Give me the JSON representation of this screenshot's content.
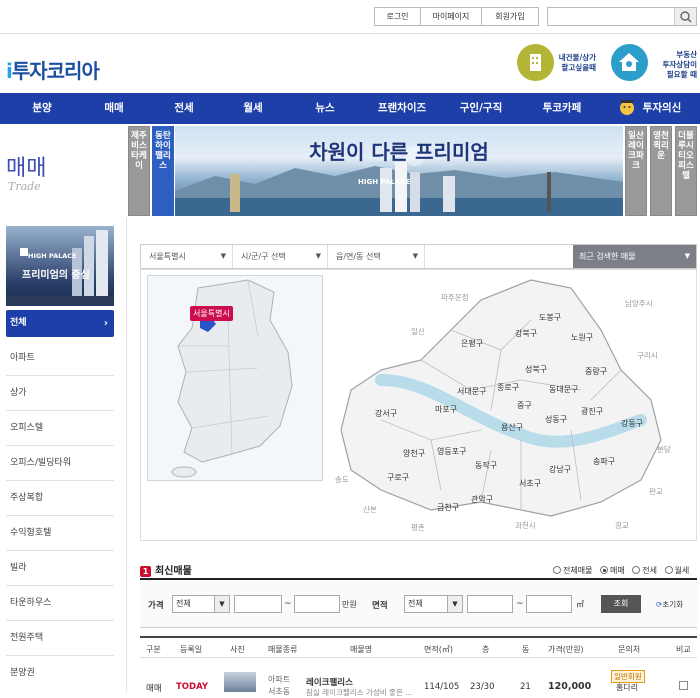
{
  "topbar": {
    "links": [
      "로그인",
      "마이페이지",
      "회원가입"
    ],
    "search_placeholder": ""
  },
  "logo": {
    "prefix": "i",
    "text": "투자코리아"
  },
  "promos": [
    {
      "line1": "내건물/상가",
      "line2": "팔고싶을때"
    },
    {
      "line1": "부동산",
      "line2": "투자상담이",
      "line3": "필요할 때"
    }
  ],
  "nav": [
    "분양",
    "매매",
    "전세",
    "월세",
    "뉴스",
    "프랜차이즈",
    "구인/구직",
    "투코카페",
    "투자의신"
  ],
  "section": {
    "title": "매매",
    "subtitle": "Trade"
  },
  "vtabs_left": [
    "제주비스타케이",
    "동탄하이팰리스"
  ],
  "vtabs_right": [
    "일산레이크파크",
    "영천퀵리운",
    "더블루시티오피스텔"
  ],
  "banner": {
    "headline": "차원이 다른 프리미엄",
    "brand": "HIGH PALACE"
  },
  "side_ad": {
    "brand": "HIGH PALACE",
    "slogan": "프리미엄의 중심"
  },
  "sidebar": {
    "items": [
      "전체",
      "아파트",
      "상가",
      "오피스텔",
      "오피스/빌딩타워",
      "주상복합",
      "수익형호텔",
      "빌라",
      "타운하우스",
      "전원주택",
      "분양권"
    ]
  },
  "region_select": {
    "city": "서울특별시",
    "gu": "시/군/구 선택",
    "dong": "읍/면/동 선택",
    "recent": "최근 검색한 매물"
  },
  "map": {
    "minimap_label": "서울특별시",
    "districts": [
      "도봉구",
      "강북구",
      "노원구",
      "은평구",
      "성북구",
      "중랑구",
      "종로구",
      "동대문구",
      "서대문구",
      "중구",
      "마포구",
      "성동구",
      "광진구",
      "강서구",
      "용산구",
      "강동구",
      "양천구",
      "영등포구",
      "동작구",
      "송파구",
      "강남구",
      "구로구",
      "서초구",
      "금천구",
      "관악구"
    ],
    "surroundings": [
      "파주운정",
      "남양주시",
      "일산",
      "구리시",
      "분당",
      "판교",
      "광교",
      "과천시",
      "평촌",
      "산본",
      "송도"
    ]
  },
  "listing": {
    "badge": "1",
    "title": "최신매물",
    "radios": [
      {
        "label": "전체매물",
        "checked": false
      },
      {
        "label": "매매",
        "checked": true
      },
      {
        "label": "전세",
        "checked": false
      },
      {
        "label": "월세",
        "checked": false
      }
    ],
    "filter": {
      "price_label": "가격",
      "price_select": "전체",
      "unit": "만원",
      "area_label": "면적",
      "area_select": "전체",
      "area_unit": "㎡",
      "search_btn": "조회",
      "reset_btn": "초기화",
      "tilde": "~"
    },
    "columns": [
      "구분",
      "등록일",
      "사진",
      "매물종류",
      "매물명",
      "면적(㎡)",
      "층",
      "동",
      "가격(만원)",
      "문의처",
      "비교"
    ],
    "rows": [
      {
        "type": "매매",
        "date": "TODAY",
        "kind": "아파트",
        "kind2": "서초동",
        "name": "레이크팰리스",
        "name2": "잠실 레이크팰리스 가성비 좋은 ...",
        "area": "114/105",
        "floor": "23/30",
        "dong": "21",
        "price": "120,000",
        "contact_badge": "일반회원",
        "contact": "홍다리"
      }
    ]
  }
}
